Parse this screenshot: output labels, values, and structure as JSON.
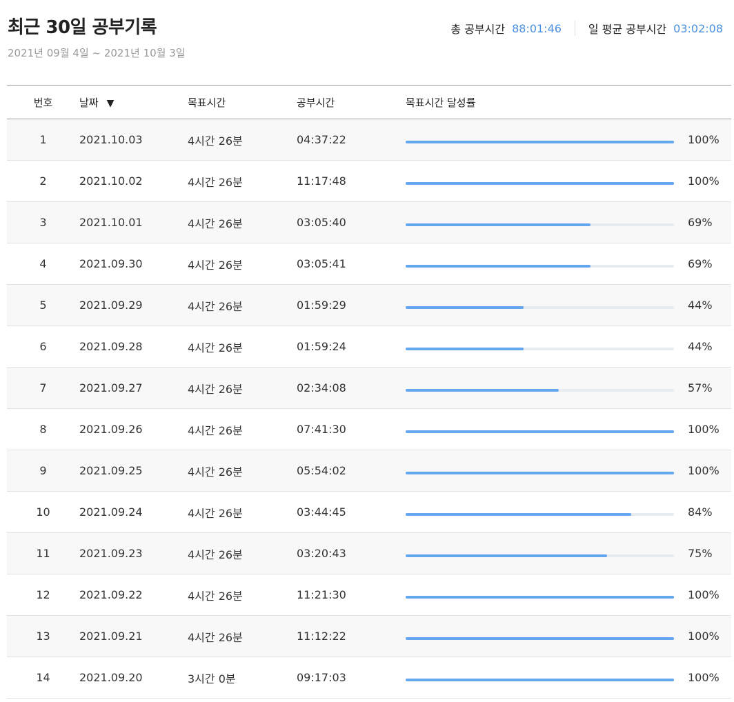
{
  "header": {
    "title": "최근 30일 공부기록",
    "date_range": "2021년 09월 4일 ~ 2021년 10월 3일",
    "total_label": "총 공부시간",
    "total_value": "88:01:46",
    "avg_label": "일 평균 공부시간",
    "avg_value": "03:02:08"
  },
  "table": {
    "columns": {
      "num": "번호",
      "date": "날짜",
      "goal": "목표시간",
      "study": "공부시간",
      "rate": "목표시간 달성률"
    },
    "sort_icon": "sort-desc-icon",
    "rows": [
      {
        "num": "1",
        "date": "2021.10.03",
        "goal": "4시간 26분",
        "study": "04:37:22",
        "rate": "100%",
        "ratio": 1.0
      },
      {
        "num": "2",
        "date": "2021.10.02",
        "goal": "4시간 26분",
        "study": "11:17:48",
        "rate": "100%",
        "ratio": 1.0
      },
      {
        "num": "3",
        "date": "2021.10.01",
        "goal": "4시간 26분",
        "study": "03:05:40",
        "rate": "69%",
        "ratio": 0.69
      },
      {
        "num": "4",
        "date": "2021.09.30",
        "goal": "4시간 26분",
        "study": "03:05:41",
        "rate": "69%",
        "ratio": 0.69
      },
      {
        "num": "5",
        "date": "2021.09.29",
        "goal": "4시간 26분",
        "study": "01:59:29",
        "rate": "44%",
        "ratio": 0.44
      },
      {
        "num": "6",
        "date": "2021.09.28",
        "goal": "4시간 26분",
        "study": "01:59:24",
        "rate": "44%",
        "ratio": 0.44
      },
      {
        "num": "7",
        "date": "2021.09.27",
        "goal": "4시간 26분",
        "study": "02:34:08",
        "rate": "57%",
        "ratio": 0.57
      },
      {
        "num": "8",
        "date": "2021.09.26",
        "goal": "4시간 26분",
        "study": "07:41:30",
        "rate": "100%",
        "ratio": 1.0
      },
      {
        "num": "9",
        "date": "2021.09.25",
        "goal": "4시간 26분",
        "study": "05:54:02",
        "rate": "100%",
        "ratio": 1.0
      },
      {
        "num": "10",
        "date": "2021.09.24",
        "goal": "4시간 26분",
        "study": "03:44:45",
        "rate": "84%",
        "ratio": 0.84
      },
      {
        "num": "11",
        "date": "2021.09.23",
        "goal": "4시간 26분",
        "study": "03:20:43",
        "rate": "75%",
        "ratio": 0.75
      },
      {
        "num": "12",
        "date": "2021.09.22",
        "goal": "4시간 26분",
        "study": "11:21:30",
        "rate": "100%",
        "ratio": 1.0
      },
      {
        "num": "13",
        "date": "2021.09.21",
        "goal": "4시간 26분",
        "study": "11:12:22",
        "rate": "100%",
        "ratio": 1.0
      },
      {
        "num": "14",
        "date": "2021.09.20",
        "goal": "3시간 0분",
        "study": "09:17:03",
        "rate": "100%",
        "ratio": 1.0
      }
    ]
  },
  "colors": {
    "accent": "#4a90e2",
    "bar_fill": "#64a6f0",
    "bar_track": "#e9ecee"
  }
}
